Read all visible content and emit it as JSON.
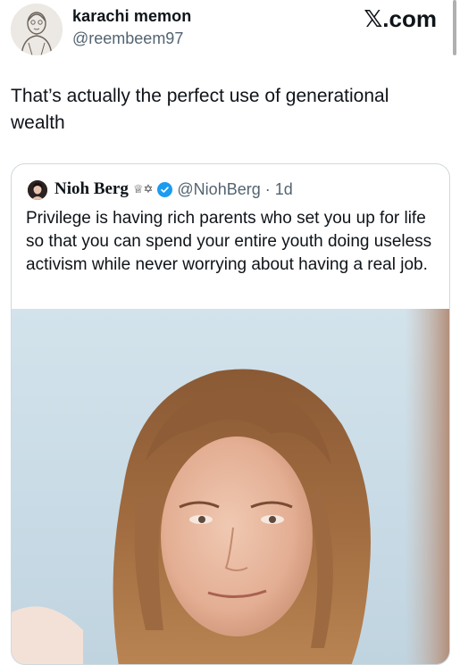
{
  "author": {
    "display_name": "karachi memon",
    "handle": "@reembeem97",
    "avatar_icon": "sketch-portrait-avatar"
  },
  "site": {
    "label": "𝕏.com"
  },
  "tweet": {
    "text": "That’s actually the perfect use of generational wealth"
  },
  "quoted_tweet": {
    "display_name": "Nioh Berg",
    "emoji": "♕✡",
    "verified_icon": "verified-badge-icon",
    "handle": "@NiohBerg",
    "separator": "·",
    "time": "1d",
    "text": "Privilege is having rich parents who set you up for life so that you can spend your entire youth doing useless activism while never worrying about having a real job.",
    "media_icon": "photo-of-person"
  },
  "colors": {
    "text_primary": "#0f1419",
    "text_secondary": "#536471",
    "verified_blue": "#1d9bf0",
    "card_border": "#cfd9de"
  }
}
